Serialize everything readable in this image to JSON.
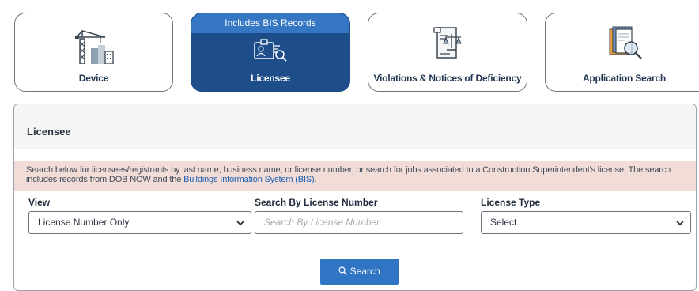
{
  "tiles": [
    {
      "label": "Device",
      "icon": "crane-building-icon"
    },
    {
      "label": "Licensee",
      "banner": "Includes BIS Records",
      "icon": "id-card-search-icon",
      "active": true
    },
    {
      "label": "Violations & Notices of Deficiency",
      "icon": "scales-document-icon"
    },
    {
      "label": "Application Search",
      "icon": "application-search-icon"
    }
  ],
  "panel": {
    "title": "Licensee",
    "notice_text": "Search below for licensees/registrants by last name, business name, or license number, or search for jobs associated to a Construction Superintendent's license. The search includes records from DOB NOW and the ",
    "notice_link": "Buildings Information System (BIS)",
    "notice_end": "."
  },
  "form": {
    "view_label": "View",
    "view_value": "License Number Only",
    "number_label": "Search By License Number",
    "number_placeholder": "Search By License Number",
    "type_label": "License Type",
    "type_value": "Select",
    "search_button": "Search"
  },
  "colors": {
    "active_tile": "#1d4e89",
    "banner": "#3577c2",
    "notice_bg": "#f1dcd8",
    "button": "#2f75c3"
  }
}
